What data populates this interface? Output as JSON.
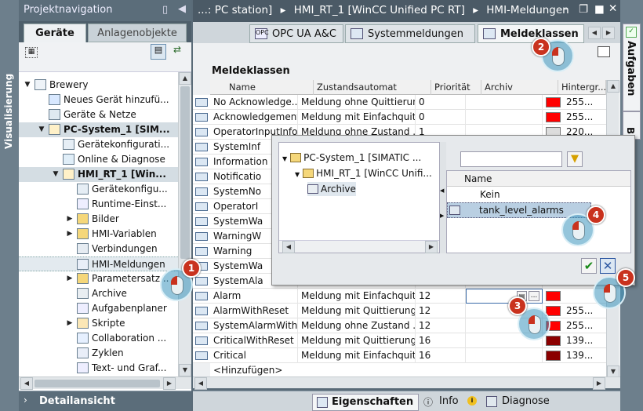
{
  "left_vertical_tab": "Visualisierung",
  "project_nav": {
    "title": "Projektnavigation",
    "tabs": [
      "Geräte",
      "Anlagenobjekte"
    ],
    "tree": [
      {
        "label": "Brewery",
        "indent": 0,
        "arrow": "down",
        "icon": "project"
      },
      {
        "label": "Neues Gerät hinzufü...",
        "indent": 1,
        "arrow": "",
        "icon": "add-device"
      },
      {
        "label": "Geräte & Netze",
        "indent": 1,
        "arrow": "",
        "icon": "network"
      },
      {
        "label": "PC-System_1 [SIM...",
        "indent": 1,
        "arrow": "down",
        "icon": "pc",
        "bold": true
      },
      {
        "label": "Gerätekonfigurati...",
        "indent": 2,
        "arrow": "",
        "icon": "config"
      },
      {
        "label": "Online & Diagnose",
        "indent": 2,
        "arrow": "",
        "icon": "online"
      },
      {
        "label": "HMI_RT_1 [Win...",
        "indent": 2,
        "arrow": "down",
        "icon": "hmi",
        "bold": true
      },
      {
        "label": "Gerätekonfigu...",
        "indent": 3,
        "arrow": "",
        "icon": "config"
      },
      {
        "label": "Runtime-Einst...",
        "indent": 3,
        "arrow": "",
        "icon": "runtime"
      },
      {
        "label": "Bilder",
        "indent": 3,
        "arrow": "right",
        "icon": "folder"
      },
      {
        "label": "HMI-Variablen",
        "indent": 3,
        "arrow": "right",
        "icon": "folder"
      },
      {
        "label": "Verbindungen",
        "indent": 3,
        "arrow": "",
        "icon": "connections"
      },
      {
        "label": "HMI-Meldungen",
        "indent": 3,
        "arrow": "",
        "icon": "alarm",
        "selected": true
      },
      {
        "label": "Parametersatz...",
        "indent": 3,
        "arrow": "right",
        "icon": "folder"
      },
      {
        "label": "Archive",
        "indent": 3,
        "arrow": "",
        "icon": "archive"
      },
      {
        "label": "Aufgabenplaner",
        "indent": 3,
        "arrow": "",
        "icon": "scheduler"
      },
      {
        "label": "Skripte",
        "indent": 3,
        "arrow": "right",
        "icon": "scripts"
      },
      {
        "label": "Collaboration ...",
        "indent": 3,
        "arrow": "",
        "icon": "collaboration"
      },
      {
        "label": "Zyklen",
        "indent": 3,
        "arrow": "",
        "icon": "cycles"
      },
      {
        "label": "Text- und Graf...",
        "indent": 3,
        "arrow": "",
        "icon": "textlist"
      }
    ],
    "detail_view": "Detailansicht"
  },
  "breadcrumb": {
    "items": [
      "...: PC station]",
      "HMI_RT_1 [WinCC Unified PC RT]",
      "HMI-Meldungen"
    ]
  },
  "editor_tabs": [
    {
      "label": "OPC UA A&C",
      "icon": "opc-icon"
    },
    {
      "label": "Systemmeldungen",
      "icon": "system-alarm-icon"
    },
    {
      "label": "Meldeklassen",
      "icon": "alarm-class-icon",
      "active": true
    }
  ],
  "right_vertical_tabs": [
    "Aufgaben",
    "Bi"
  ],
  "alarm_classes": {
    "title": "Meldeklassen",
    "columns": [
      "Name",
      "Zustandsautomat",
      "Priorität",
      "Archiv",
      "Hintergr..."
    ],
    "rows": [
      {
        "name": "No Acknowledge...",
        "state": "Meldung ohne Quittierung",
        "prio": "0",
        "archive": "",
        "color": "#ff0000",
        "bg": "255..."
      },
      {
        "name": "Acknowledgement",
        "state": "Meldung mit Einfachquit...",
        "prio": "0",
        "archive": "",
        "color": "#ff0000",
        "bg": "255..."
      },
      {
        "name": "OperatorInputInfo...",
        "state": "Meldung ohne Zustand ...",
        "prio": "1",
        "archive": "",
        "color": "#dcdcdc",
        "bg": "220..."
      },
      {
        "name": "SystemInf",
        "state": "",
        "prio": "",
        "archive": "",
        "color": "",
        "bg": ""
      },
      {
        "name": "Information",
        "state": "",
        "prio": "",
        "archive": "",
        "color": "",
        "bg": ""
      },
      {
        "name": "Notificatio",
        "state": "",
        "prio": "",
        "archive": "",
        "color": "",
        "bg": ""
      },
      {
        "name": "SystemNo",
        "state": "",
        "prio": "",
        "archive": "",
        "color": "",
        "bg": ""
      },
      {
        "name": "OperatorI",
        "state": "",
        "prio": "",
        "archive": "",
        "color": "",
        "bg": ""
      },
      {
        "name": "SystemWa",
        "state": "",
        "prio": "",
        "archive": "",
        "color": "",
        "bg": ""
      },
      {
        "name": "WarningW",
        "state": "",
        "prio": "",
        "archive": "",
        "color": "",
        "bg": ""
      },
      {
        "name": "Warning",
        "state": "",
        "prio": "",
        "archive": "",
        "color": "",
        "bg": ""
      },
      {
        "name": "SystemWa",
        "state": "",
        "prio": "",
        "archive": "",
        "color": "",
        "bg": ""
      },
      {
        "name": "SystemAla",
        "state": "",
        "prio": "",
        "archive": "",
        "color": "",
        "bg": ""
      },
      {
        "name": "Alarm",
        "state": "Meldung mit Einfachquit...",
        "prio": "12",
        "archive": "",
        "color": "#ff0000",
        "bg": "",
        "editing": true
      },
      {
        "name": "AlarmWithReset",
        "state": "Meldung mit Quittierung...",
        "prio": "12",
        "archive": "",
        "color": "#ff0000",
        "bg": "255..."
      },
      {
        "name": "SystemAlarmWith...",
        "state": "Meldung ohne Zustand ...",
        "prio": "12",
        "archive": "",
        "color": "#ff0000",
        "bg": "255..."
      },
      {
        "name": "CriticalWithReset",
        "state": "Meldung mit Quittierung...",
        "prio": "16",
        "archive": "",
        "color": "#8b0000",
        "bg": "139..."
      },
      {
        "name": "Critical",
        "state": "Meldung mit Einfachquit...",
        "prio": "16",
        "archive": "",
        "color": "#8b0000",
        "bg": "139..."
      }
    ],
    "add_row": "<Hinzufügen>"
  },
  "archive_popup": {
    "tree": [
      {
        "label": "PC-System_1 [SIMATIC ...",
        "indent": 0
      },
      {
        "label": "HMI_RT_1 [WinCC Unifi...",
        "indent": 1
      },
      {
        "label": "Archive",
        "indent": 2,
        "selected": true
      }
    ],
    "search_placeholder": "",
    "list_header": "Name",
    "items": [
      "Kein",
      "tank_level_alarms"
    ],
    "selected_item": "tank_level_alarms"
  },
  "steps": [
    "1",
    "2",
    "3",
    "4",
    "5"
  ],
  "bottom_tabs": [
    "Eigenschaften",
    "Info",
    "Diagnose"
  ],
  "colors": {
    "accent_red": "#c9321e",
    "selected_blue": "#b9cfe2"
  }
}
